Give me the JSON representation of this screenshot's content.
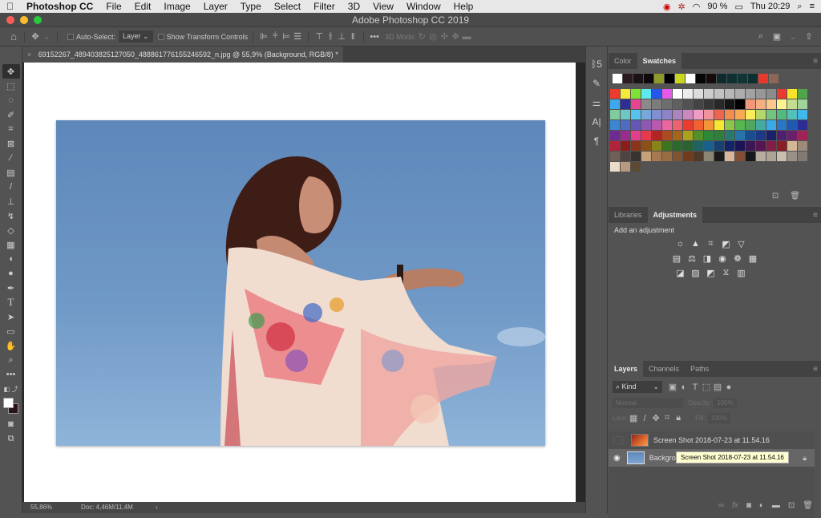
{
  "menubar": {
    "apple": "",
    "app_name": "Photoshop CC",
    "items": [
      "File",
      "Edit",
      "Image",
      "Layer",
      "Type",
      "Select",
      "Filter",
      "3D",
      "View",
      "Window",
      "Help"
    ],
    "battery": "90 %",
    "clock": "Thu 20:29"
  },
  "window": {
    "title": "Adobe Photoshop CC 2019"
  },
  "options": {
    "auto_select_label": "Auto-Select:",
    "auto_select_value": "Layer",
    "show_transform_label": "Show Transform Controls",
    "more": "•••",
    "mode_3d_label": "3D Mode:"
  },
  "document": {
    "tab_title": "69152267_489403825127050_488861776155246592_n.jpg @ 55,9% (Background, RGB/8) *",
    "close": "×"
  },
  "status": {
    "zoom": "55,86%",
    "doc": "Doc: 4,46M/11,4M",
    "arrow": "›"
  },
  "swatches_panel": {
    "tabs": [
      "Color",
      "Swatches"
    ],
    "active_tab": "Swatches",
    "recent": [
      "#ffffff",
      "#2b1a1e",
      "#1a1214",
      "#0e0a0b",
      "#8e9a2a",
      "#000000",
      "#c8d61e",
      "#ffffff",
      "#050505",
      "#150a0c",
      "#0e2a2c",
      "#0e3032",
      "#0f3434",
      "#0c3030",
      "#e83a2c",
      "#8e6658"
    ],
    "grid": [
      [
        "#ee3b2f",
        "#f5ea3a",
        "#7ee236",
        "#5ee9f2",
        "#2656ec",
        "#e35be8",
        "#ffffff",
        "#ececec",
        "#dcdcdc",
        "#cdcdcd",
        "#c2c2c2",
        "#b8b8b8",
        "#adadad",
        "#a2a2a2",
        "#979797",
        "#8c8c8c",
        "#e93a31",
        "#f5e32e",
        "#4ea648"
      ],
      [
        "#3fa8ea",
        "#2e2d94",
        "#e44490",
        "#8a8a8a",
        "#7c7c7c",
        "#6e6e6e",
        "#606060",
        "#525252",
        "#444444",
        "#363636",
        "#282828",
        "#141414",
        "#000000",
        "#f0977c",
        "#f4ae82",
        "#f9c88a",
        "#fdf48f",
        "#c4dd91",
        "#9fd39a"
      ],
      [
        "#7fcc9f",
        "#6cc7c5",
        "#56c2ee",
        "#78a7dc",
        "#7f8fd2",
        "#8e82c8",
        "#ad84c2",
        "#cd86c0",
        "#f19dc3",
        "#f1939a",
        "#ef6450",
        "#f38c4f",
        "#f7aa54",
        "#fbec5b",
        "#b5d86a",
        "#75c381",
        "#52b980",
        "#53c0b9",
        "#40b8ec"
      ],
      [
        "#3c86d4",
        "#4e6cc3",
        "#6257b5",
        "#8d59b0",
        "#b55aae",
        "#e9679e",
        "#ee6272",
        "#ed3b30",
        "#f06234",
        "#f49436",
        "#f8e830",
        "#8dc64a",
        "#56b84c",
        "#4fa85e",
        "#44aaa2",
        "#3ba9e5",
        "#2876c5",
        "#1f59b2",
        "#2c2c93"
      ],
      [
        "#6e2b94",
        "#9a2c8e",
        "#e13f8a",
        "#e5394e",
        "#b22522",
        "#ad4a1e",
        "#a6661a",
        "#a9a221",
        "#53902a",
        "#2d8938",
        "#2e7f3b",
        "#287a6e",
        "#2574aa",
        "#1a4e8c",
        "#1d3984",
        "#1c1f6a",
        "#50206f",
        "#6a1f6a",
        "#a02357"
      ],
      [
        "#b0233a",
        "#8c1e1a",
        "#8a351a",
        "#8a5216",
        "#878419",
        "#3e7420",
        "#2a6b2c",
        "#2a6232",
        "#1f6264",
        "#1d5f8c",
        "#164273",
        "#12236a",
        "#1b1457",
        "#3b1756",
        "#561651",
        "#831d45",
        "#8a1d25",
        "#d4b896",
        "#9c8a7a"
      ],
      [
        "#6f6056",
        "#4e4441",
        "#383331",
        "#c6a179",
        "#a57a53",
        "#9a6c44",
        "#7f5430",
        "#6f3d1b",
        "#4f3a2a",
        "#8c8473",
        "#1c1a18",
        "#d9b59a",
        "#814e36",
        "#16191b",
        "#b7aca0",
        "#aea495",
        "#c9bfae",
        "#9a9189",
        "#827a73"
      ],
      [
        "#eddcc8",
        "#b89a7e",
        "#5c4a33"
      ]
    ]
  },
  "adjustments_panel": {
    "tabs": [
      "Libraries",
      "Adjustments"
    ],
    "active_tab": "Adjustments",
    "heading": "Add an adjustment",
    "rows": [
      [
        "brightness-contrast",
        "levels",
        "curves",
        "exposure",
        "vibrance"
      ],
      [
        "hue-saturation",
        "color-balance",
        "black-white",
        "photo-filter",
        "channel-mixer",
        "color-lookup"
      ],
      [
        "invert",
        "posterize",
        "threshold",
        "selective-color",
        "gradient-map"
      ]
    ]
  },
  "layers_panel": {
    "tabs": [
      "Layers",
      "Channels",
      "Paths"
    ],
    "active_tab": "Layers",
    "filter_kind": "Kind",
    "blend_mode": "Normal",
    "opacity_label": "Opacity:",
    "opacity_value": "100%",
    "lock_label": "Lock:",
    "fill_label": "Fill:",
    "fill_value": "100%",
    "layers": [
      {
        "name": "Screen Shot 2018-07-23 at 11.54.16",
        "visible": false,
        "locked": false
      },
      {
        "name": "Background",
        "visible": true,
        "locked": true,
        "selected": true
      }
    ],
    "tooltip": "Screen Shot 2018-07-23 at 11.54.16"
  }
}
